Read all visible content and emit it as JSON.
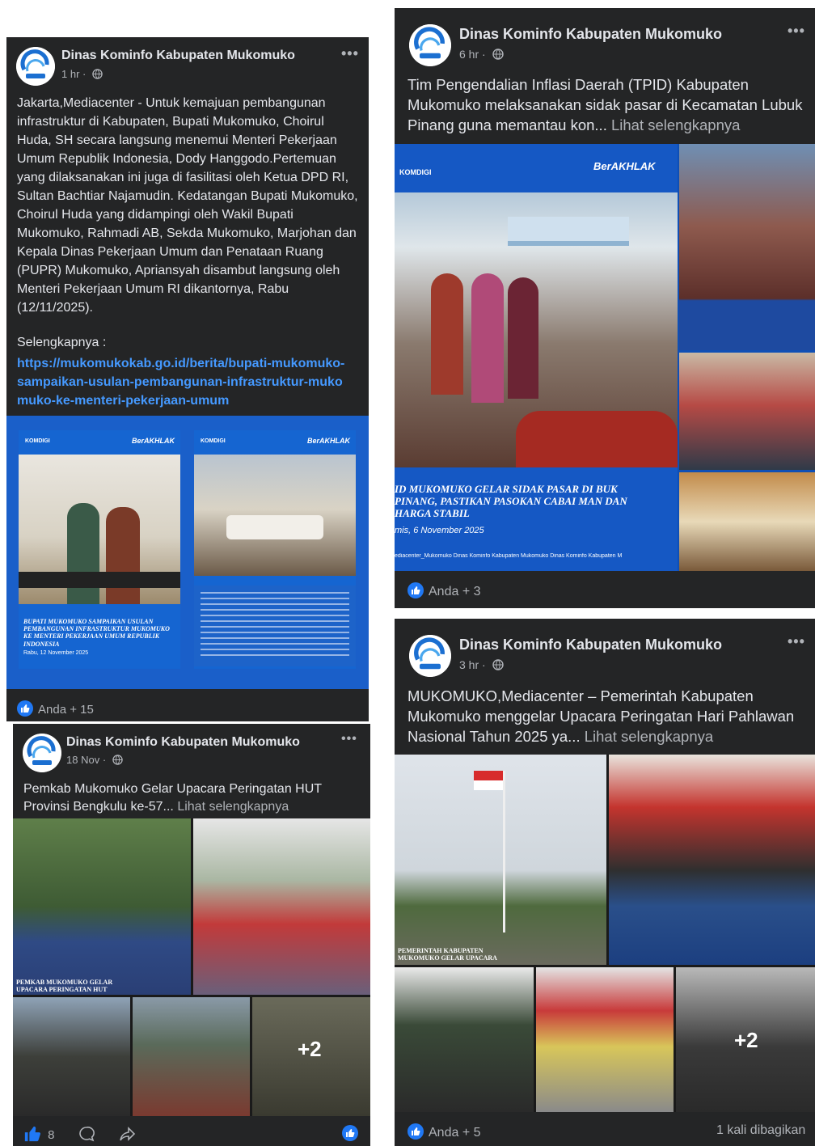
{
  "page_name": "Dinas Kominfo Kabupaten Mukomuko",
  "avatar_label": "Diskominfo",
  "posts": [
    {
      "time": "1 hr",
      "paragraph": "Jakarta,Mediacenter - Untuk kemajuan pembangunan infrastruktur di Kabupaten, Bupati Mukomuko, Choirul Huda, SH secara langsung menemui Menteri Pekerjaan Umum Republik Indonesia, Dody Hanggodo.Pertemuan yang dilaksanakan ini juga di fasilitasi oleh Ketua DPD RI, Sultan Bachtiar Najamudin. Kedatangan Bupati Mukomuko, Choirul Huda yang didampingi oleh Wakil Bupati Mukomuko, Rahmadi AB, Sekda Mukomuko, Marjohan dan Kepala Dinas Pekerjaan Umum dan Penataan Ruang (PUPR) Mukomuko, Apriansyah disambut langsung oleh Menteri Pekerjaan Umum RI dikantornya, Rabu (12/11/2025).",
      "more_label": "Selengkapnya :",
      "link": "https://mukomukokab.go.id/berita/bupati-mukomuko-sampaikan-usulan-pembangunan-infrastruktur-mukomuko-ke-menteri-pekerjaan-umum",
      "poster_headline": "BUPATI MUKOMUKO SAMPAIKAN USULAN PEMBANGUNAN INFRASTRUKTUR MUKOMUKO KE MENTERI PEKERJAAN UMUM REPUBLIK INDONESIA",
      "poster_date": "Rabu, 12 November 2025",
      "reactions": "Anda + 15"
    },
    {
      "time": "6 hr",
      "text": "Tim Pengendalian Inflasi Daerah (TPID) Kabupaten Mukomuko melaksanakan sidak pasar di Kecamatan Lubuk Pinang guna memantau kon...",
      "see_more": "Lihat selengkapnya",
      "poster_headline": "ID MUKOMUKO GELAR SIDAK PASAR DI BUK PINANG, PASTIKAN PASOKAN CABAI MAN DAN HARGA STABIL",
      "poster_date": "mis, 6 November 2025",
      "footer_handles": "ediacenter_Mukomuko   Dinas Kominfo Kabupaten Mukomuko   Dinas Kominfo Kabupaten M",
      "reactions": "Anda + 3"
    },
    {
      "time": "18 Nov",
      "text": "Pemkab Mukomuko Gelar Upacara Peringatan HUT Provinsi Bengkulu ke-57...",
      "see_more": "Lihat selengkapnya",
      "poster_headline": "PEMKAB MUKOMUKO GELAR UPACARA PERINGATAN HUT",
      "more_photos": "+2",
      "like_count": "8"
    },
    {
      "time": "3 hr",
      "text": "MUKOMUKO,Mediacenter – Pemerintah Kabupaten Mukomuko menggelar Upacara Peringatan Hari Pahlawan Nasional Tahun 2025 ya...",
      "see_more": "Lihat selengkapnya",
      "poster_headline": "PEMERINTAH KABUPATEN MUKOMUKO GELAR UPACARA",
      "more_photos": "+2",
      "reactions": "Anda + 5",
      "shares": "1 kali dibagikan"
    }
  ],
  "brand": {
    "kominfo": "KOMDIGI",
    "berakhlak": "BerAKHLAK"
  },
  "colors": {
    "card_bg": "#242526",
    "text": "#e4e6eb",
    "muted": "#b0b3b8",
    "link": "#4599ff",
    "poster_blue": "#1558c4",
    "like_blue": "#2078f4"
  }
}
